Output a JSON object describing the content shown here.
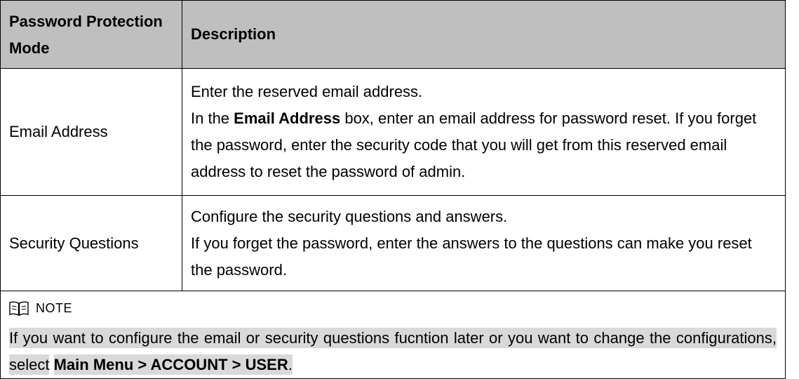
{
  "table": {
    "header": {
      "col1": "Password Protection Mode",
      "col2": "Description"
    },
    "rows": [
      {
        "mode": "Email Address",
        "lines": [
          "Enter the reserved email address.",
          "In the",
          "Email Address",
          "box, enter an email address for password reset. If you forget the password, enter the security code that you will get from this reserved email address to reset the password of admin."
        ]
      },
      {
        "mode": "Security Questions",
        "lines": [
          "Configure the security questions and answers.",
          "If you forget the password, enter the answers to the questions can make you reset the password."
        ]
      }
    ],
    "note": {
      "title": "NOTE",
      "text_before": "If you want to configure the email or security questions fucntion later or you want to change the configurations, select",
      "path": "Main Menu > ACCOUNT > USER",
      "text_after": "."
    }
  }
}
